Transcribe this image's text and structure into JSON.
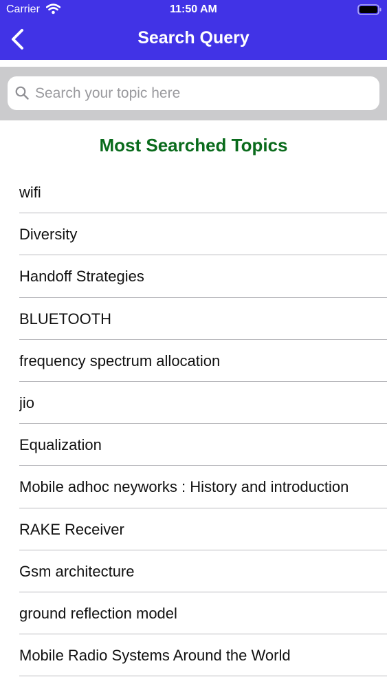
{
  "status_bar": {
    "carrier": "Carrier",
    "time": "11:50 AM",
    "wifi_icon": "wifi-icon",
    "battery_icon": "battery-icon"
  },
  "nav": {
    "title": "Search Query",
    "back_icon": "chevron-left-icon",
    "background_color": "#4133e6"
  },
  "search": {
    "placeholder": "Search your topic here",
    "value": "",
    "icon": "search-icon"
  },
  "section": {
    "title": "Most Searched Topics",
    "title_color": "#0a6b1c"
  },
  "topics": [
    {
      "label": "wifi"
    },
    {
      "label": "Diversity"
    },
    {
      "label": "Handoff Strategies"
    },
    {
      "label": "BLUETOOTH"
    },
    {
      "label": "frequency spectrum allocation"
    },
    {
      "label": "jio"
    },
    {
      "label": "Equalization"
    },
    {
      "label": "Mobile adhoc neyworks : History and introduction"
    },
    {
      "label": "RAKE Receiver"
    },
    {
      "label": "Gsm architecture"
    },
    {
      "label": "ground reflection model"
    },
    {
      "label": "Mobile Radio Systems Around the World"
    }
  ]
}
